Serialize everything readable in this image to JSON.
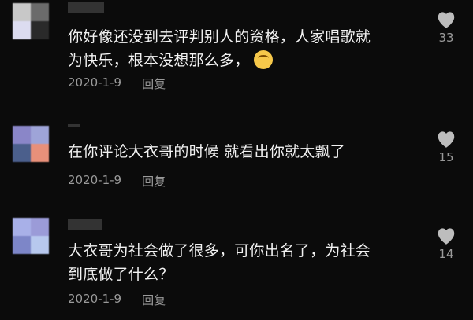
{
  "comments": [
    {
      "text_line1": "你好像还没到去评判别人的资格，人家唱歌就",
      "text_line2": "为快乐，根本没想那么多，",
      "date": "2020-1-9",
      "reply_label": "回复",
      "likes": "33",
      "avatar_colors": [
        "#c8c8c8",
        "#6b6b6b",
        "#dcdcf0",
        "#2a2a2a"
      ],
      "emoji": "thinking-face-icon"
    },
    {
      "text_line1": "在你评论大衣哥的时候 就看出你就太飘了",
      "date": "2020-1-9",
      "reply_label": "回复",
      "likes": "15",
      "avatar_colors": [
        "#8a86c8",
        "#9ea4d8",
        "#4b5f8c",
        "#e8907a"
      ]
    },
    {
      "text_line1": "大衣哥为社会做了很多，可你出名了，为社会",
      "text_line2": "到底做了什么？",
      "date": "2020-1-9",
      "reply_label": "回复",
      "likes": "14",
      "avatar_colors": [
        "#a8b0e8",
        "#9b9bd8",
        "#7d86c8",
        "#b7c8ee"
      ]
    }
  ]
}
